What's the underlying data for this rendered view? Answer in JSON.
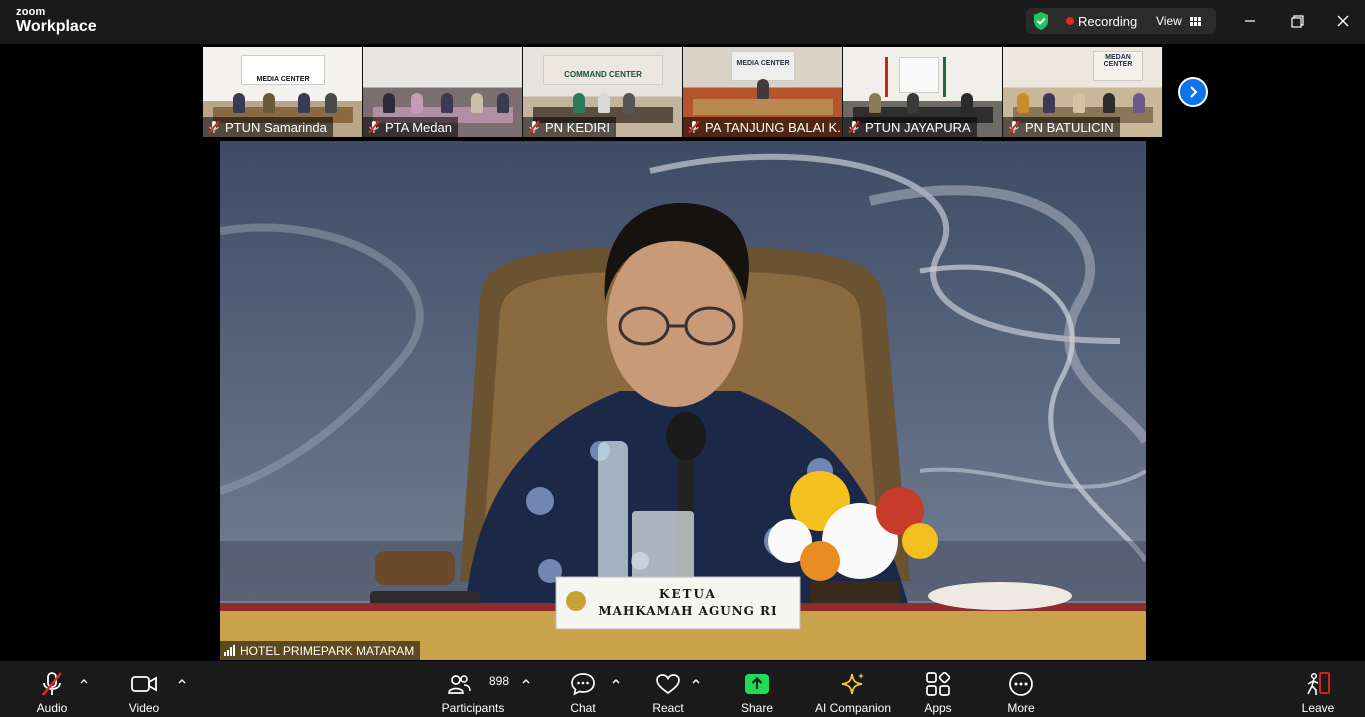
{
  "app": {
    "brand_small": "zoom",
    "brand_big": "Workplace"
  },
  "status": {
    "recording_label": "Recording",
    "view_label": "View"
  },
  "window_controls": [
    "minimize",
    "restore",
    "close"
  ],
  "participants_strip": [
    {
      "name": "PTUN Samarinda",
      "banner": "MEDIA CENTER",
      "muted": true
    },
    {
      "name": "PTA Medan",
      "banner": "",
      "muted": true
    },
    {
      "name": "PN KEDIRI",
      "banner": "COMMAND CENTER",
      "muted": true
    },
    {
      "name": "PA TANJUNG BALAI K...",
      "banner": "MEDIA CENTER",
      "muted": true
    },
    {
      "name": "PTUN JAYAPURA",
      "banner": "",
      "muted": true
    },
    {
      "name": "PN BATULICIN",
      "banner": "MEDAN CENTER",
      "muted": true
    }
  ],
  "main_video": {
    "location_label": "HOTEL PRIMEPARK MATARAM",
    "nameplate_line1": "KETUA",
    "nameplate_line2": "MAHKAMAH AGUNG RI"
  },
  "toolbar": {
    "audio": "Audio",
    "video": "Video",
    "participants": "Participants",
    "participants_count": "898",
    "chat": "Chat",
    "react": "React",
    "share": "Share",
    "ai_companion": "AI Companion",
    "apps": "Apps",
    "more": "More",
    "leave": "Leave"
  },
  "colors": {
    "share_green": "#23d959",
    "leave_red": "#e02828",
    "accent_blue": "#0e72ed",
    "ai_gold": "#f5c542"
  }
}
